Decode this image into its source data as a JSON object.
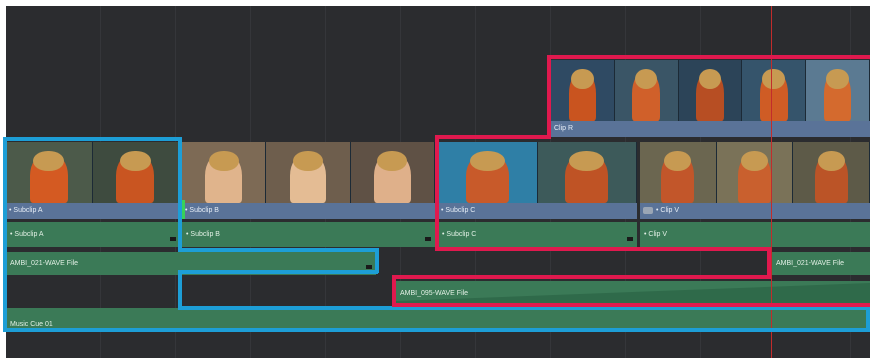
{
  "clips": {
    "video_top": {
      "label": "Clip R"
    },
    "video_track1": [
      {
        "label": "• Subclip A"
      },
      {
        "label": "• Subclip B"
      },
      {
        "label": "• Subclip C"
      },
      {
        "label": "• Clip V"
      }
    ],
    "audio_track1": [
      {
        "label": "• Subclip A"
      },
      {
        "label": "• Subclip B"
      },
      {
        "label": "• Subclip C"
      },
      {
        "label": "• Clip V"
      }
    ],
    "audio_track2": [
      {
        "label": "AMBI_021-WAVE File"
      },
      {
        "label": "AMBI_021-WAVE File"
      }
    ],
    "audio_track3": [
      {
        "label": "AMBI_095-WAVE File"
      }
    ],
    "audio_track4": [
      {
        "label": "Music Cue 01"
      }
    ]
  },
  "colors": {
    "highlight_blue": "#1d9ed6",
    "highlight_red": "#e0194e",
    "video_clip": "#5a7398",
    "audio_clip": "#3b7a57",
    "playhead": "#c22c2c"
  }
}
